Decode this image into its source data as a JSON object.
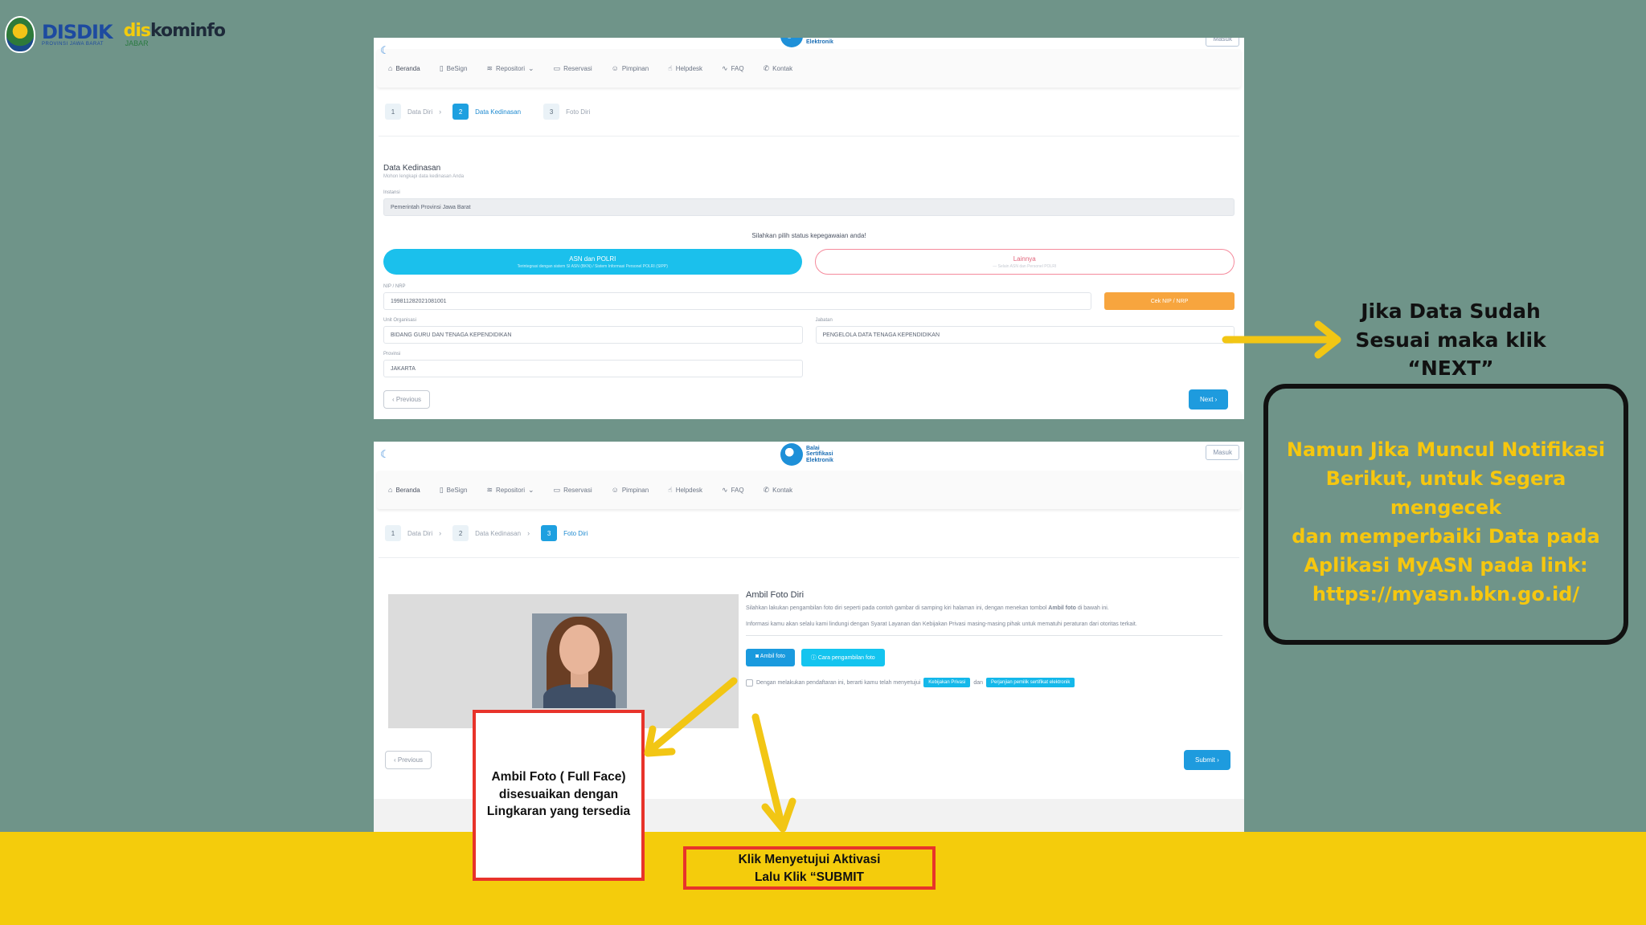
{
  "logos": {
    "disdik": "DISDIK",
    "disdik_sub": "PROVINSI JAWA BARAT",
    "diskominfo_a": "dis",
    "diskominfo_b": "kominfo",
    "diskominfo_sub": "JABAR"
  },
  "app": {
    "brand_line1": "Balai",
    "brand_line2": "Sertifikasi",
    "brand_line3": "Elektronik",
    "login_button": "Masuk"
  },
  "nav": {
    "items": [
      {
        "label": "Beranda",
        "icon": "home-icon"
      },
      {
        "label": "BeSign",
        "icon": "document-icon"
      },
      {
        "label": "Repositori",
        "icon": "layers-icon"
      },
      {
        "label": "Reservasi",
        "icon": "calendar-icon"
      },
      {
        "label": "Pimpinan",
        "icon": "person-icon"
      },
      {
        "label": "Helpdesk",
        "icon": "thumbs-up-icon"
      },
      {
        "label": "FAQ",
        "icon": "activity-icon"
      },
      {
        "label": "Kontak",
        "icon": "phone-icon"
      }
    ]
  },
  "steps": [
    {
      "num": "1",
      "label": "Data Diri"
    },
    {
      "num": "2",
      "label": "Data Kedinasan"
    },
    {
      "num": "3",
      "label": "Foto Diri"
    }
  ],
  "kedinasan": {
    "title": "Data Kedinasan",
    "subtitle": "Mohon lengkapi data kedinasan Anda",
    "instansi_label": "Instansi",
    "instansi_value": "Pemerintah Provinsi Jawa Barat",
    "status_prompt": "Silahkan pilih status kepegawaian anda!",
    "asn_title": "ASN dan POLRI",
    "asn_sub": "Terintegrasi dengan sistem SI ASN (BKN) / Sistem Informasi Personel POLRI (SIPP)",
    "lain_title": "Lainnya",
    "lain_sub": "— Selain ASN dan Personel POLRI",
    "nip_label": "NIP / NRP",
    "nip_value": "199811282021081001",
    "cek_button": "Cek NIP / NRP",
    "unit_label": "Unit Organisasi",
    "unit_value": "BIDANG GURU DAN TENAGA KEPENDIDIKAN",
    "jabatan_label": "Jabatan",
    "jabatan_value": "PENGELOLA DATA TENAGA KEPENDIDIKAN",
    "provinsi_label": "Provinsi",
    "provinsi_value": "JAKARTA",
    "prev_button": "‹ Previous",
    "next_button": "Next ›"
  },
  "foto": {
    "title": "Ambil Foto Diri",
    "para1_a": "Silahkan lakukan pengambilan foto diri seperti pada contoh gambar di samping kiri halaman ini, dengan menekan tombol ",
    "para1_b": "Ambil foto",
    "para1_c": " di bawah ini.",
    "para2": "Informasi kamu akan selalu kami lindungi dengan Syarat Layanan dan Kebijakan Privasi masing-masing pihak untuk mematuhi peraturan dari otoritas terkait.",
    "take_button": "Ambil foto",
    "how_button": "Cara pengambilan foto",
    "consent_text": "Dengan melakukan pendaftaran ini, berarti kamu telah menyetujui",
    "policy_link": "Kebijakan Privasi",
    "and_text": "dan",
    "agreement_link": "Perjanjian pemilik sertifikat elektronik",
    "prev_button": "‹ Previous",
    "submit_button": "Submit ›"
  },
  "annotations": {
    "next_line1": "Jika Data Sudah",
    "next_line2": "Sesuai maka klik",
    "next_line3": "“NEXT”",
    "notif_line1": "Namun Jika Muncul Notifikasi",
    "notif_line2": "Berikut, untuk Segera mengecek",
    "notif_line3": "dan memperbaiki Data pada",
    "notif_line4": "Aplikasi MyASN pada link:",
    "notif_line5": "https://myasn.bkn.go.id/",
    "foto_line1": "Ambil Foto ( Full Face)",
    "foto_line2": "disesuaikan dengan",
    "foto_line3": "Lingkaran yang tersedia",
    "submit_line1": "Klik Menyetujui Aktivasi",
    "submit_line2": "Lalu Klik “SUBMIT"
  },
  "colors": {
    "background": "#6f9489",
    "band": "#f4cc0c",
    "arrow": "#f2c614",
    "annotation_box": "#e8332a"
  }
}
